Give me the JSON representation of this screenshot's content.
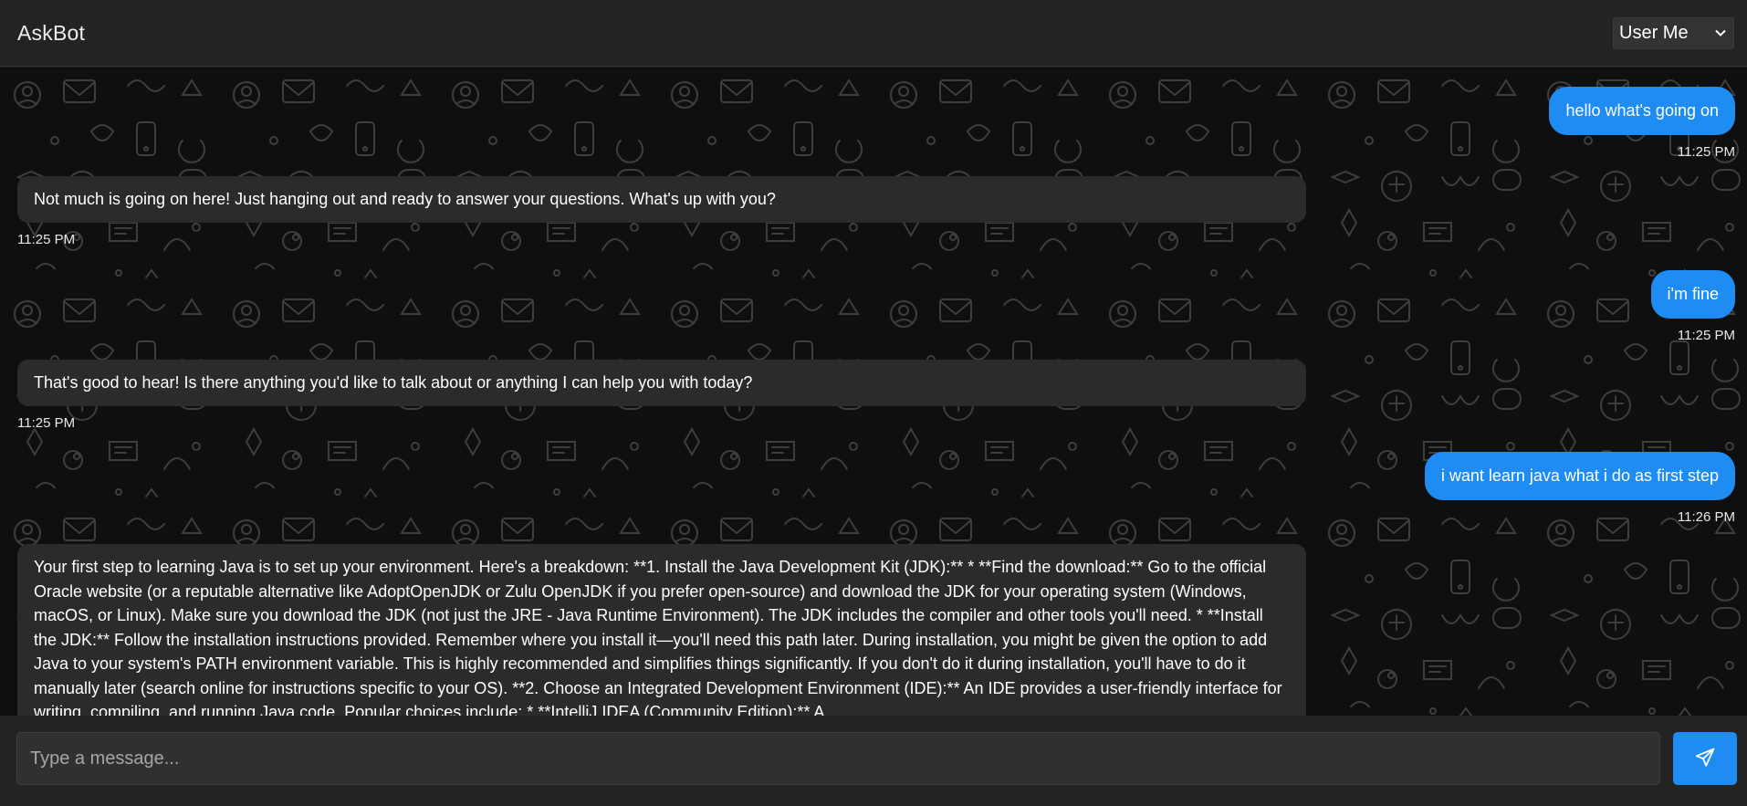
{
  "header": {
    "title": "AskBot",
    "user_select": {
      "selected": "User Me"
    }
  },
  "messages": [
    {
      "role": "user",
      "text": "hello what's going on",
      "time": "11:25 PM"
    },
    {
      "role": "bot",
      "text": "Not much is going on here! Just hanging out and ready to answer your questions. What's up with you?",
      "time": "11:25 PM"
    },
    {
      "role": "user",
      "text": "i'm fine",
      "time": "11:25 PM"
    },
    {
      "role": "bot",
      "text": "That's good to hear! Is there anything you'd like to talk about or anything I can help you with today?",
      "time": "11:25 PM"
    },
    {
      "role": "user",
      "text": "i want learn java what i do as first step",
      "time": "11:26 PM"
    },
    {
      "role": "bot",
      "text": "Your first step to learning Java is to set up your environment. Here's a breakdown: **1. Install the Java Development Kit (JDK):** * **Find the download:** Go to the official Oracle website (or a reputable alternative like AdoptOpenJDK or Zulu OpenJDK if you prefer open-source) and download the JDK for your operating system (Windows, macOS, or Linux). Make sure you download the JDK (not just the JRE - Java Runtime Environment). The JDK includes the compiler and other tools you'll need. * **Install the JDK:** Follow the installation instructions provided. Remember where you install it—you'll need this path later. During installation, you might be given the option to add Java to your system's PATH environment variable. This is highly recommended and simplifies things significantly. If you don't do it during installation, you'll have to do it manually later (search online for instructions specific to your OS). **2. Choose an Integrated Development Environment (IDE):** An IDE provides a user-friendly interface for writing, compiling, and running Java code. Popular choices include: * **IntelliJ IDEA (Community Edition):** A"
    }
  ],
  "composer": {
    "placeholder": "Type a message..."
  },
  "icons": {
    "user_select_toggle": "chevron-down-icon",
    "send": "send-icon"
  },
  "colors": {
    "accent": "#1e8cf3",
    "bot_bubble": "#2b2b2b",
    "header_bg": "#232323"
  }
}
